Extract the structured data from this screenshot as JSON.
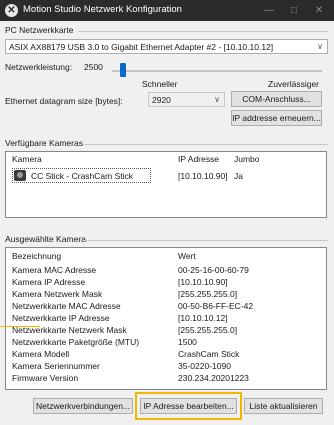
{
  "window": {
    "title": "Motion Studio Netzwerk Konfiguration",
    "minimize": "—",
    "maximize": "□",
    "close": "✕"
  },
  "pc": {
    "group_label": "PC Netzwerkkarte",
    "adapter": "ASIX AX88179 USB 3.0 to Gigabit Ethernet Adapter #2 - [10.10.10.12]",
    "power_label": "Netzwerkleistung:",
    "power_value": "2500",
    "slider_level_fraction": 0.04,
    "slider_left_label": "Schneller",
    "slider_right_label": "Zuverlässiger",
    "datagram_label": "Ethernet datagram size [bytes]:",
    "datagram_value": "2920",
    "com_button": "COM-Anschluss...",
    "renew_button": "IP addresse erneuern..."
  },
  "cameras": {
    "group_label": "Verfügbare Kameras",
    "headers": [
      "Kamera",
      "IP Adresse",
      "Jumbo"
    ],
    "rows": [
      {
        "name": "CC Stick - CrashCam Stick",
        "ip": "[10.10.10.90]",
        "jumbo": "Ja"
      }
    ]
  },
  "selected": {
    "group_label": "Ausgewählte Kamera",
    "headers": [
      "Bezeichnung",
      "Wert"
    ],
    "rows": [
      {
        "label": "Kamera MAC Adresse",
        "value": "00-25-16-00-60-79"
      },
      {
        "label": "Kamera IP Adresse",
        "value": "[10.10.10.90]"
      },
      {
        "label": "Kamera Netzwerk Mask",
        "value": "[255.255.255.0]"
      },
      {
        "label": "Netzwerkkarte MAC Adresse",
        "value": "00-50-B6-FF-EC-42"
      },
      {
        "label": "Netzwerkkarte IP Adresse",
        "value": "[10.10.10.12]"
      },
      {
        "label": "Netzwerkkarte Netzwerk Mask",
        "value": "[255.255.255.0]"
      },
      {
        "label": "Netzwerkkarte Paketgröße (MTU)",
        "value": "1500"
      },
      {
        "label": "Kamera Modell",
        "value": "CrashCam Stick"
      },
      {
        "label": "Kamera Seriennummer",
        "value": "35-0220-1090"
      },
      {
        "label": "Firmware Version",
        "value": "230.234.20201223"
      }
    ]
  },
  "buttons": {
    "net": "Netzwerkverbindungen...",
    "edit_ip": "IP Adresse bearbeiten...",
    "refresh": "Liste aktualisieren"
  },
  "colors": {
    "titlebar": "#2b2b2b",
    "accent": "#0a6cc8",
    "highlight": "#f2b500"
  },
  "icons": {
    "app": "app-logo-icon",
    "camera": "camera-icon",
    "dropdown": "chevron-down-icon"
  }
}
